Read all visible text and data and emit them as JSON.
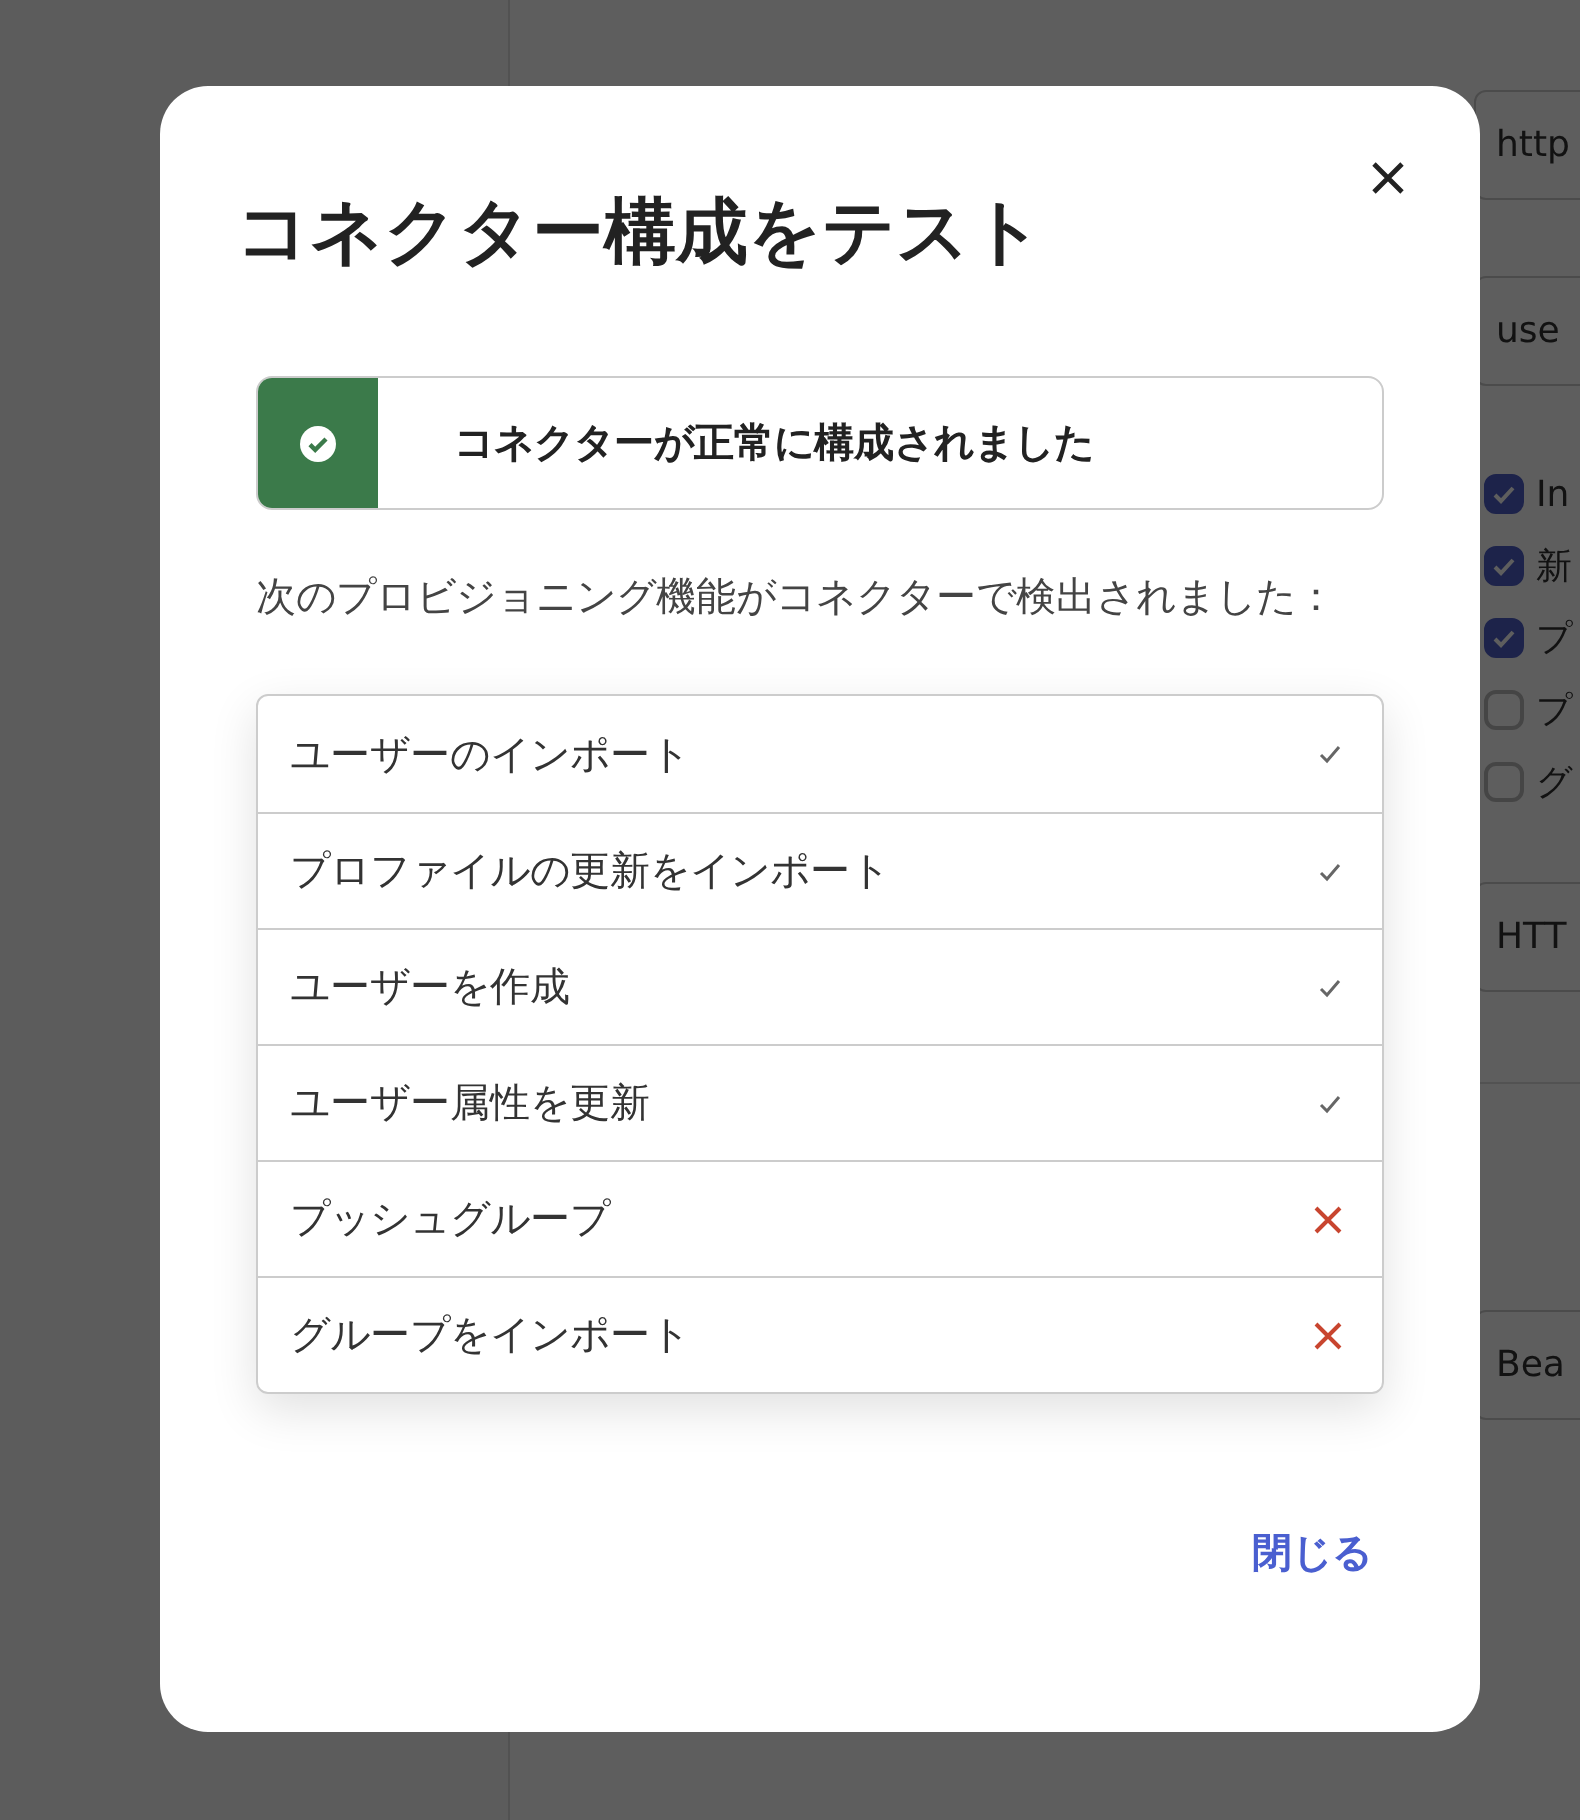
{
  "background": {
    "fields": [
      {
        "value": "http"
      },
      {
        "value": "use"
      }
    ],
    "checkboxes": [
      {
        "label": "In",
        "checked": true
      },
      {
        "label": "新",
        "checked": true
      },
      {
        "label": "プ",
        "checked": true
      },
      {
        "label": "プ",
        "checked": false
      },
      {
        "label": "グ",
        "checked": false
      }
    ],
    "fields_lower": [
      {
        "value": "HTT"
      },
      {
        "value": "Bea"
      }
    ]
  },
  "dialog": {
    "title": "コネクター構成をテスト",
    "banner": {
      "text": "コネクターが正常に構成されました"
    },
    "description": "次のプロビジョニング機能がコネクターで検出されました：",
    "capabilities": [
      {
        "label": "ユーザーのインポート",
        "supported": true
      },
      {
        "label": "プロファイルの更新をインポート",
        "supported": true
      },
      {
        "label": "ユーザーを作成",
        "supported": true
      },
      {
        "label": "ユーザー属性を更新",
        "supported": true
      },
      {
        "label": "プッシュグループ",
        "supported": false
      },
      {
        "label": "グループをインポート",
        "supported": false
      }
    ],
    "close_button": "閉じる"
  }
}
